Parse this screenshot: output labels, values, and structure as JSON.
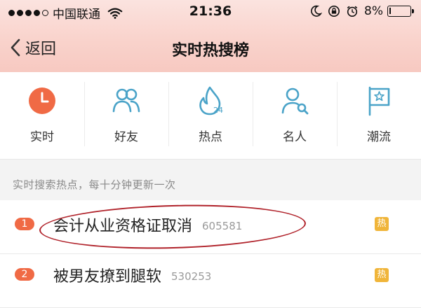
{
  "status_bar": {
    "carrier": "中国联通",
    "time": "21:36",
    "battery": "8%",
    "battery_level": 0.08,
    "signal_bars_filled": 4,
    "signal_bars_total": 5
  },
  "nav": {
    "back_label": "返回",
    "title": "实时热搜榜"
  },
  "categories": [
    {
      "label": "实时",
      "icon": "clock-icon"
    },
    {
      "label": "好友",
      "icon": "friends-icon"
    },
    {
      "label": "热点",
      "icon": "flame-24-icon",
      "icon_text": "24"
    },
    {
      "label": "名人",
      "icon": "person-search-icon"
    },
    {
      "label": "潮流",
      "icon": "flag-star-icon"
    }
  ],
  "section_title": "实时搜索热点，每十分钟更新一次",
  "hot_list": [
    {
      "rank": "1",
      "title": "会计从业资格证取消",
      "count": "605581",
      "badge": "热"
    },
    {
      "rank": "2",
      "title": "被男友撩到腿软",
      "count": "530253",
      "badge": "热"
    }
  ],
  "colors": {
    "header_bg": "#f9d3cc",
    "accent_red": "#f06a45",
    "icon_blue": "#4aa3c8",
    "hot_badge": "#f0b53a",
    "annotation_circle": "#b0222a"
  }
}
